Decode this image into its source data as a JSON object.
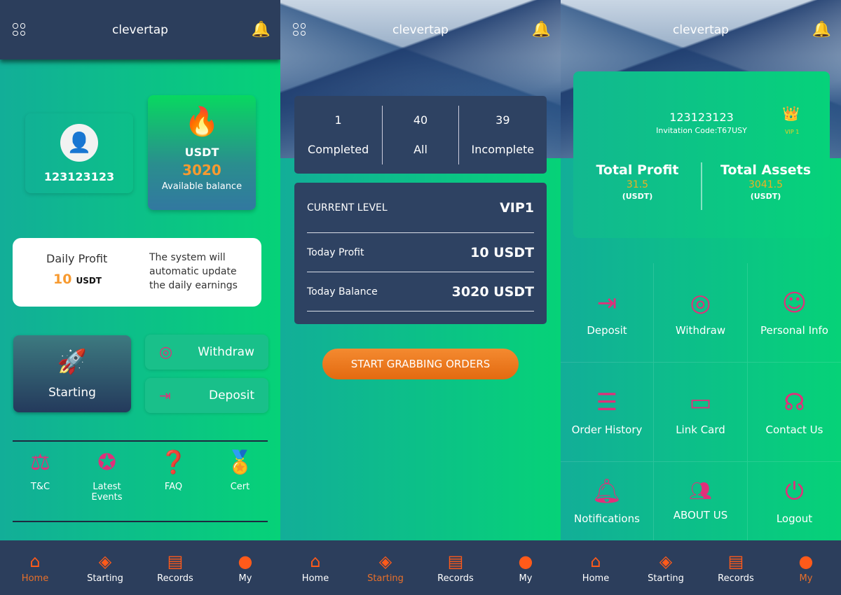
{
  "app_title": "clevertap",
  "nav": [
    {
      "label": "Home",
      "icon": "home-icon"
    },
    {
      "label": "Starting",
      "icon": "diamond-icon"
    },
    {
      "label": "Records",
      "icon": "records-icon"
    },
    {
      "label": "My",
      "icon": "user-info-icon"
    }
  ],
  "home": {
    "username": "123123123",
    "balance_currency": "USDT",
    "balance": "3020",
    "balance_label": "Available balance",
    "daily_profit_label": "Daily Profit",
    "daily_profit_value": "10",
    "daily_profit_unit": "USDT",
    "daily_note": "The system will automatic update the daily earnings",
    "starting_label": "Starting",
    "withdraw_label": "Withdraw",
    "deposit_label": "Deposit",
    "links": [
      {
        "label": "T&C",
        "icon": "gavel-icon"
      },
      {
        "label": "Latest Events",
        "icon": "star-icon"
      },
      {
        "label": "FAQ",
        "icon": "question-icon"
      },
      {
        "label": "Cert",
        "icon": "medal-icon"
      }
    ],
    "active_nav": "Home"
  },
  "starting": {
    "stats": [
      {
        "value": "1",
        "label": "Completed"
      },
      {
        "value": "40",
        "label": "All"
      },
      {
        "value": "39",
        "label": "Incomplete"
      }
    ],
    "current_level_label": "CURRENT LEVEL",
    "current_level": "VIP1",
    "today_profit_label": "Today Profit",
    "today_profit": "10 USDT",
    "today_balance_label": "Today Balance",
    "today_balance": "3020 USDT",
    "start_button": "START GRABBING ORDERS",
    "active_nav": "Starting"
  },
  "my": {
    "username": "123123123",
    "invitation_code": "Invitation Code:T67USY",
    "vip": "VIP 1",
    "total_profit_label": "Total Profit",
    "total_profit": "31.5",
    "total_profit_unit": "(USDT)",
    "total_assets_label": "Total Assets",
    "total_assets": "3041.5",
    "total_assets_unit": "(USDT)",
    "menu": [
      {
        "label": "Deposit",
        "icon": "deposit-icon"
      },
      {
        "label": "Withdraw",
        "icon": "withdraw-icon"
      },
      {
        "label": "Personal Info",
        "icon": "personal-info-icon"
      },
      {
        "label": "Order History",
        "icon": "order-history-icon"
      },
      {
        "label": "Link Card",
        "icon": "card-icon"
      },
      {
        "label": "Contact Us",
        "icon": "headset-icon"
      },
      {
        "label": "Notifications",
        "icon": "bell-icon"
      },
      {
        "label": "ABOUT US",
        "icon": "users-icon"
      },
      {
        "label": "Logout",
        "icon": "power-icon"
      }
    ],
    "active_nav": "My"
  },
  "colors": {
    "accent": "#e9702a",
    "dark": "#2c3e5c",
    "pink": "#e0307a",
    "gold": "#f0b020"
  }
}
